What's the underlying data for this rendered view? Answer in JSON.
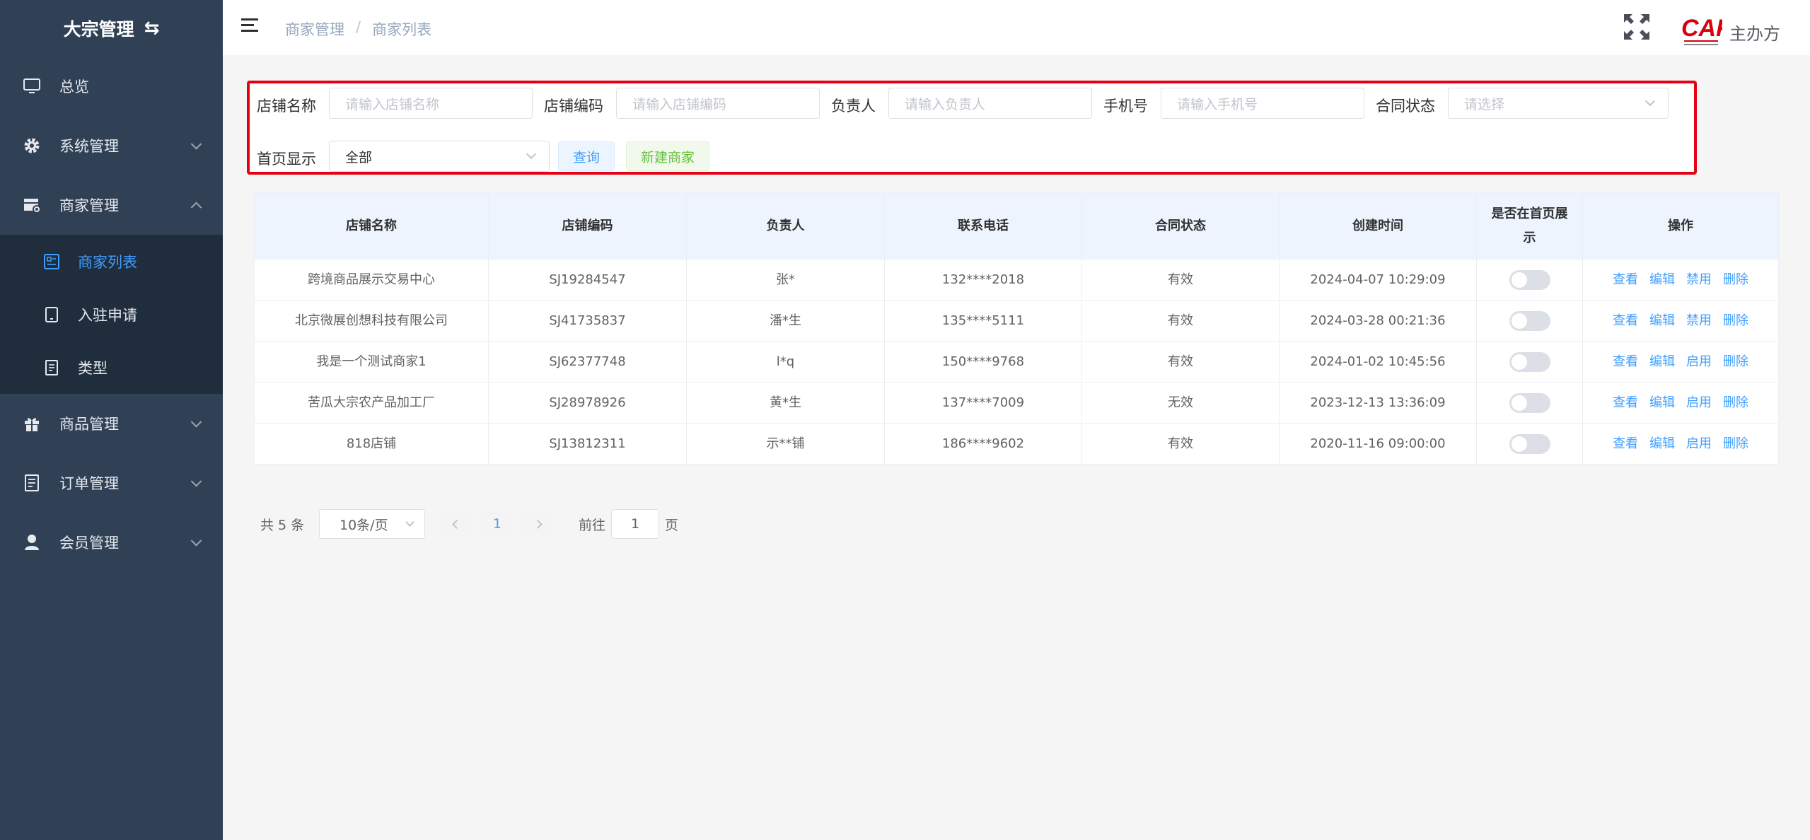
{
  "sidebar": {
    "title": "大宗管理",
    "items": [
      {
        "label": "总览",
        "icon": "monitor-icon"
      },
      {
        "label": "系统管理",
        "icon": "gear-icon"
      },
      {
        "label": "商家管理",
        "icon": "store-icon"
      },
      {
        "label": "商品管理",
        "icon": "gift-icon"
      },
      {
        "label": "订单管理",
        "icon": "document-icon"
      },
      {
        "label": "会员管理",
        "icon": "user-icon"
      }
    ],
    "submenu": [
      {
        "label": "商家列表",
        "icon": "list-icon",
        "active": true
      },
      {
        "label": "入驻申请",
        "icon": "tablet-icon"
      },
      {
        "label": "类型",
        "icon": "file-icon"
      }
    ]
  },
  "header": {
    "breadcrumb": [
      "商家管理",
      "商家列表"
    ],
    "separator": "/",
    "org_label": "主办方"
  },
  "filter": {
    "shop_name_label": "店铺名称",
    "shop_name_placeholder": "请输入店铺名称",
    "shop_code_label": "店铺编码",
    "shop_code_placeholder": "请输入店铺编码",
    "manager_label": "负责人",
    "manager_placeholder": "请输入负责人",
    "phone_label": "手机号",
    "phone_placeholder": "请输入手机号",
    "contract_label": "合同状态",
    "contract_placeholder": "请选择",
    "home_label": "首页显示",
    "home_value": "全部",
    "query_button": "查询",
    "new_button": "新建商家"
  },
  "table": {
    "columns": [
      "店铺名称",
      "店铺编码",
      "负责人",
      "联系电话",
      "合同状态",
      "创建时间",
      "是否在首页展示",
      "操作"
    ],
    "rows": [
      {
        "name": "跨境商品展示交易中心",
        "code": "SJ19284547",
        "manager": "张*",
        "phone": "132****2018",
        "status": "有效",
        "created": "2024-04-07 10:29:09",
        "on_home": false,
        "ops": [
          "查看",
          "编辑",
          "禁用",
          "删除"
        ]
      },
      {
        "name": "北京微展创想科技有限公司",
        "code": "SJ41735837",
        "manager": "潘*生",
        "phone": "135****5111",
        "status": "有效",
        "created": "2024-03-28 00:21:36",
        "on_home": false,
        "ops": [
          "查看",
          "编辑",
          "禁用",
          "删除"
        ]
      },
      {
        "name": "我是一个测试商家1",
        "code": "SJ62377748",
        "manager": "l*q",
        "phone": "150****9768",
        "status": "有效",
        "created": "2024-01-02 10:45:56",
        "on_home": false,
        "ops": [
          "查看",
          "编辑",
          "启用",
          "删除"
        ]
      },
      {
        "name": "苦瓜大宗农产品加工厂",
        "code": "SJ28978926",
        "manager": "黄*生",
        "phone": "137****7009",
        "status": "无效",
        "created": "2023-12-13 13:36:09",
        "on_home": false,
        "ops": [
          "查看",
          "编辑",
          "启用",
          "删除"
        ]
      },
      {
        "name": "818店铺",
        "code": "SJ13812311",
        "manager": "示**铺",
        "phone": "186****9602",
        "status": "有效",
        "created": "2020-11-16 09:00:00",
        "on_home": false,
        "ops": [
          "查看",
          "编辑",
          "启用",
          "删除"
        ]
      }
    ]
  },
  "pagination": {
    "total_text": "共 5 条",
    "page_size": "10条/页",
    "current_page": "1",
    "goto_label": "前往",
    "goto_value": "1",
    "goto_unit": "页"
  },
  "colors": {
    "sidebar_bg": "#304156",
    "submenu_bg": "#1f2d3d",
    "accent": "#409eff",
    "highlight_border": "#e60012",
    "success": "#67c23a"
  }
}
